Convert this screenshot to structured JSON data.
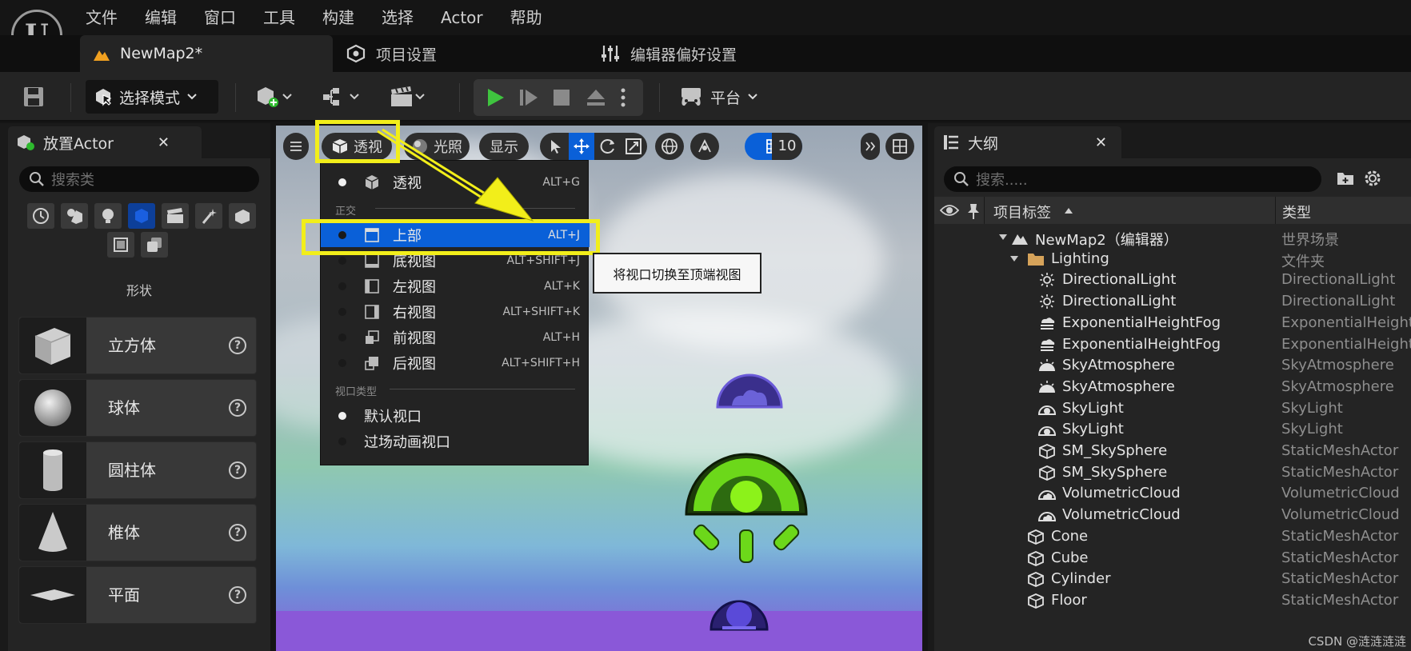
{
  "app": {
    "logo_letter": "U"
  },
  "menubar": [
    "文件",
    "编辑",
    "窗口",
    "工具",
    "构建",
    "选择",
    "Actor",
    "帮助"
  ],
  "tabs": {
    "map_tab": "NewMap2*",
    "project_settings": "项目设置",
    "editor_prefs": "编辑器偏好设置"
  },
  "toolbar": {
    "mode_label": "选择模式",
    "platform_label": "平台"
  },
  "place_actor": {
    "title": "放置Actor",
    "search_placeholder": "搜索类",
    "section_label": "形状",
    "shapes": [
      {
        "label": "立方体",
        "icon": "cube-icon"
      },
      {
        "label": "球体",
        "icon": "sphere-icon"
      },
      {
        "label": "圆柱体",
        "icon": "cylinder-icon"
      },
      {
        "label": "椎体",
        "icon": "cone-icon"
      },
      {
        "label": "平面",
        "icon": "plane-icon"
      }
    ]
  },
  "viewport_toolbar": {
    "view_label": "透视",
    "lighting_label": "光照",
    "show_label": "显示",
    "grid_value": "10"
  },
  "view_menu": {
    "perspective": {
      "label": "透视",
      "shortcut": "ALT+G"
    },
    "section_ortho": "正交",
    "items": [
      {
        "label": "上部",
        "shortcut": "ALT+J"
      },
      {
        "label": "底视图",
        "shortcut": "ALT+SHIFT+J"
      },
      {
        "label": "左视图",
        "shortcut": "ALT+K"
      },
      {
        "label": "右视图",
        "shortcut": "ALT+SHIFT+K"
      },
      {
        "label": "前视图",
        "shortcut": "ALT+H"
      },
      {
        "label": "后视图",
        "shortcut": "ALT+SHIFT+H"
      }
    ],
    "section_viewport_type": "视口类型",
    "types": [
      "默认视口",
      "过场动画视口"
    ]
  },
  "tooltip": "将视口切换至顶端视图",
  "outline": {
    "title": "大纲",
    "search_placeholder": "搜索.....",
    "col_label": "项目标签",
    "col_type": "类型",
    "rows": [
      {
        "label": "NewMap2（编辑器）",
        "type": "世界场景",
        "icon": "map-icon",
        "indent": 0
      },
      {
        "label": "Lighting",
        "type": "文件夹",
        "icon": "folder-icon",
        "indent": 1
      },
      {
        "label": "DirectionalLight",
        "type": "DirectionalLight",
        "icon": "sun-icon",
        "indent": 2
      },
      {
        "label": "DirectionalLight",
        "type": "DirectionalLight",
        "icon": "sun-icon",
        "indent": 2
      },
      {
        "label": "ExponentialHeightFog",
        "type": "ExponentialHeightFog",
        "icon": "fog-icon",
        "indent": 2
      },
      {
        "label": "ExponentialHeightFog",
        "type": "ExponentialHeightFog",
        "icon": "fog-icon",
        "indent": 2
      },
      {
        "label": "SkyAtmosphere",
        "type": "SkyAtmosphere",
        "icon": "atmosphere-icon",
        "indent": 2
      },
      {
        "label": "SkyAtmosphere",
        "type": "SkyAtmosphere",
        "icon": "atmosphere-icon",
        "indent": 2
      },
      {
        "label": "SkyLight",
        "type": "SkyLight",
        "icon": "skylight-icon",
        "indent": 2
      },
      {
        "label": "SkyLight",
        "type": "SkyLight",
        "icon": "skylight-icon",
        "indent": 2
      },
      {
        "label": "SM_SkySphere",
        "type": "StaticMeshActor",
        "icon": "mesh-icon",
        "indent": 2
      },
      {
        "label": "SM_SkySphere",
        "type": "StaticMeshActor",
        "icon": "mesh-icon",
        "indent": 2
      },
      {
        "label": "VolumetricCloud",
        "type": "VolumetricCloud",
        "icon": "cloud-icon",
        "indent": 2
      },
      {
        "label": "VolumetricCloud",
        "type": "VolumetricCloud",
        "icon": "cloud-icon",
        "indent": 2
      },
      {
        "label": "Cone",
        "type": "StaticMeshActor",
        "icon": "mesh-icon",
        "indent": 1
      },
      {
        "label": "Cube",
        "type": "StaticMeshActor",
        "icon": "mesh-icon",
        "indent": 1
      },
      {
        "label": "Cylinder",
        "type": "StaticMeshActor",
        "icon": "mesh-icon",
        "indent": 1
      },
      {
        "label": "Floor",
        "type": "StaticMeshActor",
        "icon": "mesh-icon",
        "indent": 1
      }
    ]
  },
  "watermark": "CSDN @涟涟涟涟",
  "colors": {
    "highlight": "#f2ee1a",
    "selected_row": "#0a60d8",
    "play_green": "#3fc43f"
  }
}
